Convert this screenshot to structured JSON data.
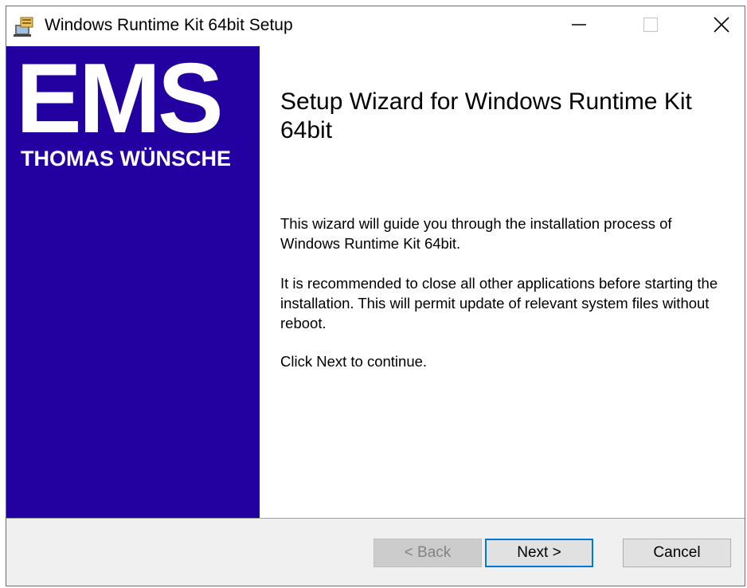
{
  "window": {
    "title": "Windows Runtime Kit 64bit Setup",
    "app_icon": "installer-icon",
    "controls": {
      "minimize_icon": "minimize-icon",
      "maximize_icon": "maximize-icon",
      "close_icon": "close-icon"
    }
  },
  "banner": {
    "logo_text": "EMS",
    "logo_subtitle": "THOMAS WÜNSCHE",
    "background_color": "#2300a0"
  },
  "content": {
    "heading": "Setup Wizard for Windows Runtime Kit 64bit",
    "paragraphs": [
      "This wizard will guide you through the installation process of Windows Runtime Kit 64bit.",
      "It is recommended to close all other applications before starting the installation. This will permit update of relevant system files without reboot.",
      "Click Next to continue."
    ]
  },
  "footer": {
    "back_label": "< Back",
    "back_enabled": false,
    "next_label": "Next >",
    "cancel_label": "Cancel",
    "accent_color": "#0078d7"
  }
}
